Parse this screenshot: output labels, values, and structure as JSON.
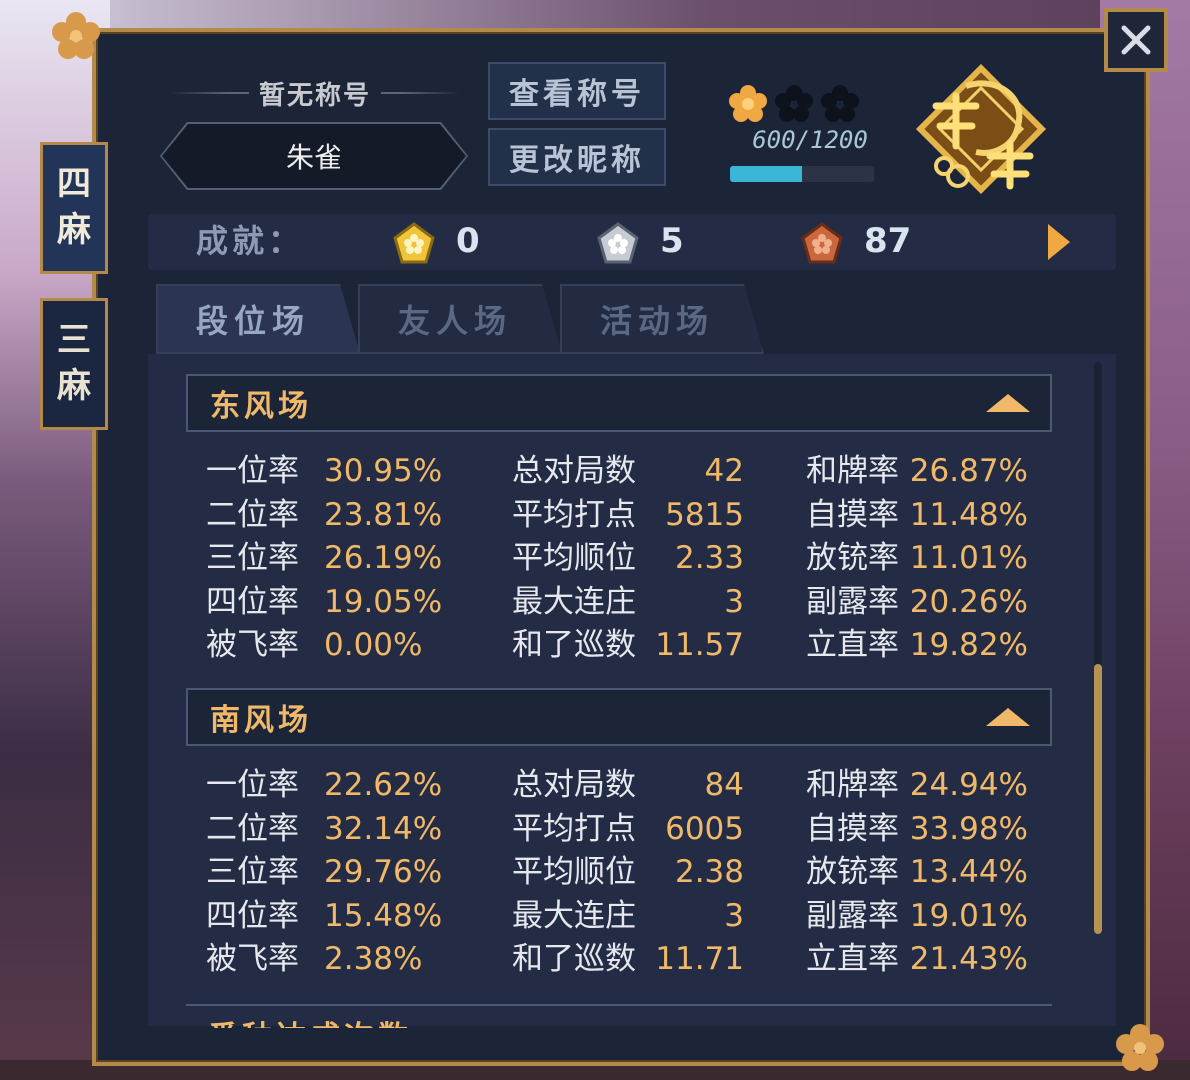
{
  "side_tabs": [
    {
      "label_top": "四",
      "label_bottom": "麻"
    },
    {
      "label_top": "三",
      "label_bottom": "麻"
    }
  ],
  "header": {
    "no_title": "暂无称号",
    "nickname": "朱雀",
    "view_title_button": "查看称号",
    "change_nickname_button": "更改昵称",
    "stars_filled": 1,
    "stars_total": 3,
    "rank_score": "600/1200",
    "rank_progress": 0.5,
    "rank_emblem_icon": "jieshi-peacock-emblem"
  },
  "achievements": {
    "label": "成就：",
    "gold": "0",
    "silver": "5",
    "bronze": "87"
  },
  "mode_tabs": [
    "段位场",
    "友人场",
    "活动场"
  ],
  "sections": [
    {
      "title": "东风场",
      "col1": [
        {
          "label": "一位率",
          "value": "30.95%"
        },
        {
          "label": "二位率",
          "value": "23.81%"
        },
        {
          "label": "三位率",
          "value": "26.19%"
        },
        {
          "label": "四位率",
          "value": "19.05%"
        },
        {
          "label": "被飞率",
          "value": "0.00%"
        }
      ],
      "col2": [
        {
          "label": "总对局数",
          "value": "42"
        },
        {
          "label": "平均打点",
          "value": "5815"
        },
        {
          "label": "平均顺位",
          "value": "2.33"
        },
        {
          "label": "最大连庄",
          "value": "3"
        },
        {
          "label": "和了巡数",
          "value": "11.57"
        }
      ],
      "col3": [
        {
          "label": "和牌率",
          "value": "26.87%"
        },
        {
          "label": "自摸率",
          "value": "11.48%"
        },
        {
          "label": "放铳率",
          "value": "11.01%"
        },
        {
          "label": "副露率",
          "value": "20.26%"
        },
        {
          "label": "立直率",
          "value": "19.82%"
        }
      ]
    },
    {
      "title": "南风场",
      "col1": [
        {
          "label": "一位率",
          "value": "22.62%"
        },
        {
          "label": "二位率",
          "value": "32.14%"
        },
        {
          "label": "三位率",
          "value": "29.76%"
        },
        {
          "label": "四位率",
          "value": "15.48%"
        },
        {
          "label": "被飞率",
          "value": "2.38%"
        }
      ],
      "col2": [
        {
          "label": "总对局数",
          "value": "84"
        },
        {
          "label": "平均打点",
          "value": "6005"
        },
        {
          "label": "平均顺位",
          "value": "2.38"
        },
        {
          "label": "最大连庄",
          "value": "3"
        },
        {
          "label": "和了巡数",
          "value": "11.71"
        }
      ],
      "col3": [
        {
          "label": "和牌率",
          "value": "24.94%"
        },
        {
          "label": "自摸率",
          "value": "33.98%"
        },
        {
          "label": "放铳率",
          "value": "13.44%"
        },
        {
          "label": "副露率",
          "value": "19.01%"
        },
        {
          "label": "立直率",
          "value": "21.43%"
        }
      ]
    }
  ],
  "partial_section_title": "番种达成次数",
  "colors": {
    "accent_gold": "#f0b96a",
    "panel_bg": "#1c2438",
    "frame_gold": "#b38a4a",
    "progress_cyan": "#3cb6d6"
  }
}
